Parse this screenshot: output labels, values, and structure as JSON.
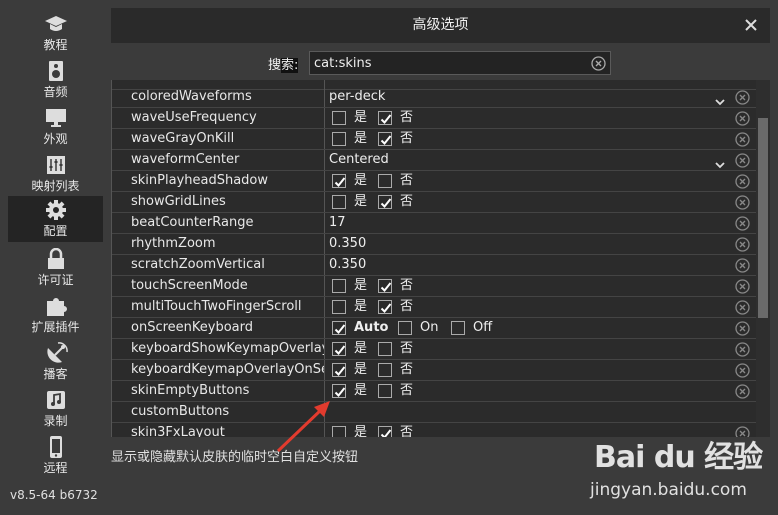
{
  "sidebar": {
    "items": [
      {
        "label": "教程",
        "icon": "graduation-cap-icon"
      },
      {
        "label": "音频",
        "icon": "speaker-icon"
      },
      {
        "label": "外观",
        "icon": "monitor-icon"
      },
      {
        "label": "映射列表",
        "icon": "sliders-icon"
      },
      {
        "label": "配置",
        "icon": "gear-icon",
        "active": true
      },
      {
        "label": "许可证",
        "icon": "lock-icon"
      },
      {
        "label": "扩展插件",
        "icon": "puzzle-icon"
      },
      {
        "label": "播客",
        "icon": "satellite-dish-icon"
      },
      {
        "label": "录制",
        "icon": "music-note-icon"
      },
      {
        "label": "远程",
        "icon": "phone-icon"
      }
    ],
    "version": "v8.5-64 b6732"
  },
  "dialog": {
    "title": "高级选项",
    "search_label_a": "搜",
    "search_label_b": "索:",
    "search_value": "cat:skins",
    "description": "显示或隐藏默认皮肤的临时空白自定义按钮"
  },
  "labels": {
    "yes": "是",
    "no": "否",
    "auto": "Auto",
    "on": "On",
    "off": "Off"
  },
  "rows": [
    {
      "name": "coloredWaveforms",
      "type": "select",
      "value": "per-deck"
    },
    {
      "name": "waveUseFrequency",
      "type": "yesno",
      "yes": false,
      "no": true
    },
    {
      "name": "waveGrayOnKill",
      "type": "yesno",
      "yes": false,
      "no": true
    },
    {
      "name": "waveformCenter",
      "type": "select",
      "value": "Centered"
    },
    {
      "name": "skinPlayheadShadow",
      "type": "yesno",
      "yes": true,
      "no": false
    },
    {
      "name": "showGridLines",
      "type": "yesno",
      "yes": false,
      "no": true
    },
    {
      "name": "beatCounterRange",
      "type": "text",
      "value": "17"
    },
    {
      "name": "rhythmZoom",
      "type": "text",
      "value": "0.350"
    },
    {
      "name": "scratchZoomVertical",
      "type": "text",
      "value": "0.350"
    },
    {
      "name": "touchScreenMode",
      "type": "yesno",
      "yes": false,
      "no": true
    },
    {
      "name": "multiTouchTwoFingerScroll",
      "type": "yesno",
      "yes": false,
      "no": true
    },
    {
      "name": "onScreenKeyboard",
      "type": "tri",
      "auto": true,
      "on": false,
      "off": false
    },
    {
      "name": "keyboardShowKeymapOverlay",
      "type": "yesno",
      "yes": true,
      "no": false
    },
    {
      "name": "keyboardKeymapOverlayOnSecondScreen",
      "type": "yesno",
      "yes": true,
      "no": false
    },
    {
      "name": "skinEmptyButtons",
      "type": "yesno",
      "yes": true,
      "no": false
    },
    {
      "name": "customButtons",
      "type": "empty"
    },
    {
      "name": "skin3FxLayout",
      "type": "yesno",
      "yes": false,
      "no": true
    }
  ],
  "watermark": {
    "logo": "Bai du 经验",
    "url": "jingyan.baidu.com"
  }
}
